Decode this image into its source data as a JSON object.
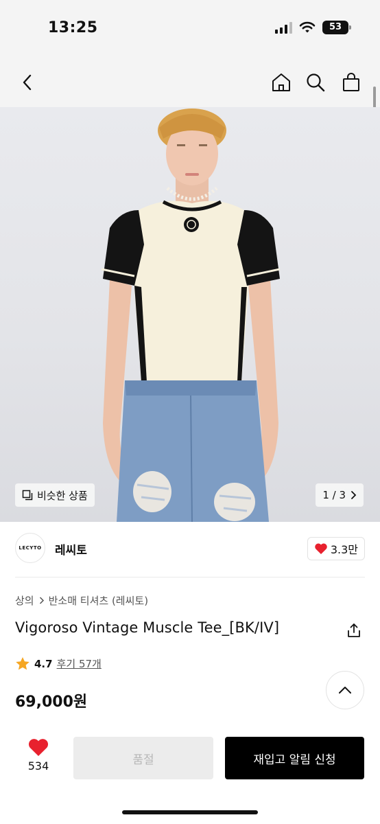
{
  "status_bar": {
    "time": "13:25",
    "battery": "53"
  },
  "nav": {
    "back_icon": "chevron-left-icon",
    "home_icon": "home-icon",
    "search_icon": "search-icon",
    "bag_icon": "shopping-bag-icon"
  },
  "gallery": {
    "similar_label": "비슷한 상품",
    "page_indicator": "1 / 3"
  },
  "brand": {
    "logo_text": "LECYTO",
    "name": "레씨토",
    "likes": "3.3만"
  },
  "product": {
    "breadcrumb": [
      "상의",
      "반소매 티셔츠 (레씨토)"
    ],
    "title": "Vigoroso Vintage Muscle Tee_[BK/IV]",
    "rating": "4.7",
    "review_text": "후기 57개",
    "price": "69,000원"
  },
  "actions": {
    "wish_count": "534",
    "soldout_label": "품절",
    "restock_label": "재입고 알림 신청"
  },
  "colors": {
    "heart": "#e8212e",
    "star": "#f5a623",
    "primary_button": "#000000",
    "disabled_button": "#ececec"
  }
}
